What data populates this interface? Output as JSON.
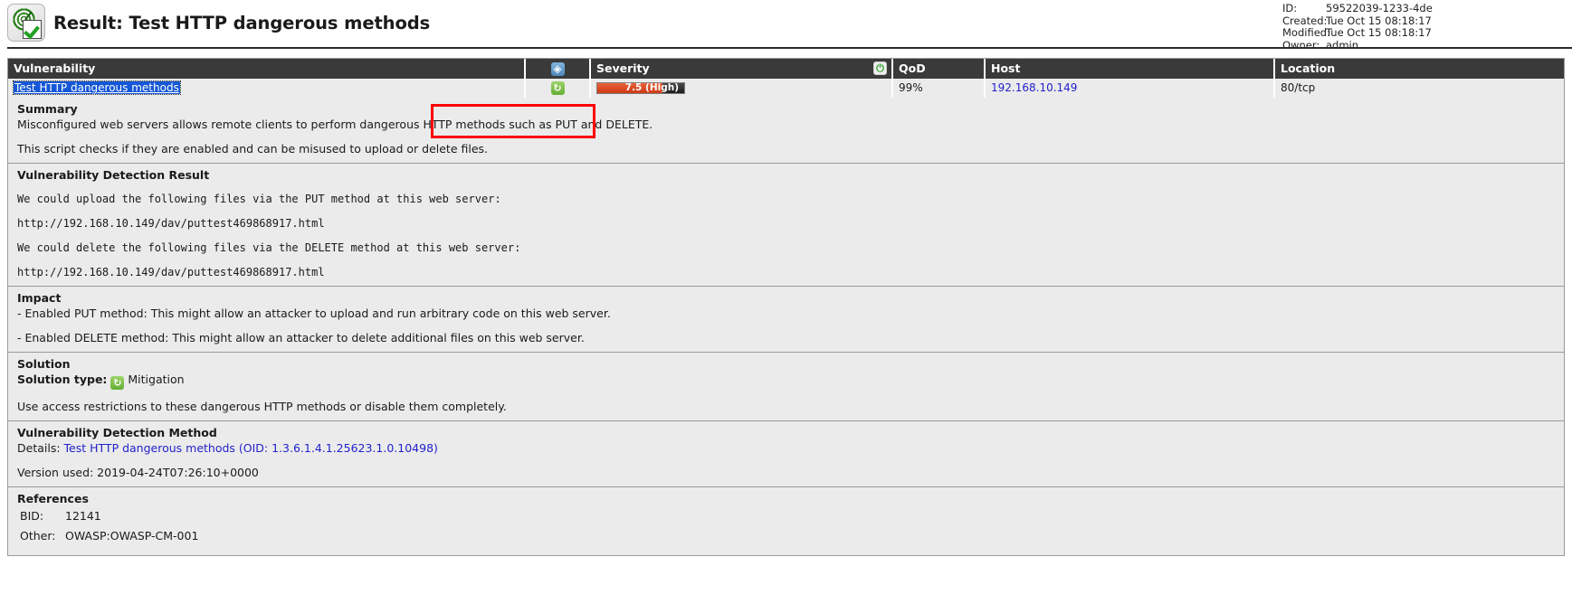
{
  "header": {
    "logo_icon": "greenbone-radar-check-icon",
    "title": "Result: Test HTTP dangerous methods",
    "meta": [
      {
        "key": "ID:",
        "value": "59522039-1233-4de"
      },
      {
        "key": "Created:",
        "value": "Tue Oct 15 08:18:17"
      },
      {
        "key": "Modified:",
        "value": "Tue Oct 15 08:18:17"
      },
      {
        "key": "Owner:",
        "value": "admin"
      }
    ]
  },
  "table": {
    "columns": {
      "vulnerability": "Vulnerability",
      "solution_type_icon": "puzzle-icon",
      "severity": "Severity",
      "severity_icon": "power-icon",
      "qod": "QoD",
      "host": "Host",
      "location": "Location"
    },
    "row": {
      "vulnerability": "Test HTTP dangerous methods",
      "solution_type_icon": "mitigation-icon",
      "severity_value": "7.5 (High)",
      "severity_score": 7.5,
      "severity_max": 10,
      "severity_color": "#cc3a16",
      "qod": "99%",
      "host": "192.168.10.149",
      "location": "80/tcp"
    }
  },
  "summary": {
    "heading": "Summary",
    "line1": "Misconfigured web servers allows remote clients to perform dangerous HTTP methods such as PUT and DELETE.",
    "line2": "This script checks if they are enabled and can be misused to upload or delete files."
  },
  "detection_result": {
    "heading": "Vulnerability Detection Result",
    "lines": [
      "We could upload the following files via the PUT method at this web server:",
      "http://192.168.10.149/dav/puttest469868917.html",
      "We could delete the following files via the DELETE method at this web server:",
      "http://192.168.10.149/dav/puttest469868917.html"
    ]
  },
  "impact": {
    "heading": "Impact",
    "line1": "- Enabled PUT method: This might allow an attacker to upload and run arbitrary code on this web server.",
    "line2": "- Enabled DELETE method: This might allow an attacker to delete additional files on this web server."
  },
  "solution": {
    "heading": "Solution",
    "type_label": "Solution type:",
    "type_icon": "mitigation-icon",
    "type_value": "Mitigation",
    "text": "Use access restrictions to these dangerous HTTP methods or disable them completely."
  },
  "detection_method": {
    "heading": "Vulnerability Detection Method",
    "details_label": "Details:",
    "details_link": "Test HTTP dangerous methods (OID: 1.3.6.1.4.1.25623.1.0.10498)",
    "version_used": "Version used: 2019-04-24T07:26:10+0000"
  },
  "references": {
    "heading": "References",
    "items": [
      {
        "key": "BID:",
        "value": "12141"
      },
      {
        "key": "Other:",
        "value": "OWASP:OWASP-CM-001"
      }
    ]
  },
  "annotation": {
    "shape": "red-rectangle-highlight",
    "color": "#ff0000"
  }
}
